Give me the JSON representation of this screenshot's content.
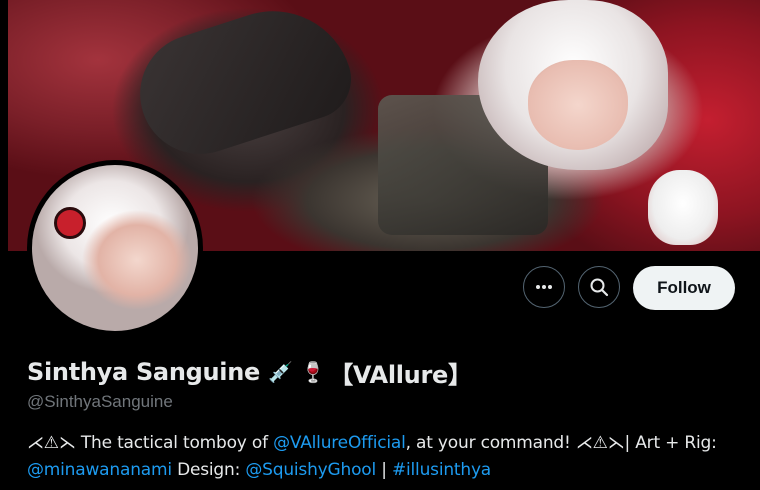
{
  "profile": {
    "display_name": "Sinthya Sanguine",
    "name_emojis": [
      "💉",
      "🍷"
    ],
    "name_tag": "【VAllure】",
    "handle": "@SinthyaSanguine"
  },
  "actions": {
    "more_icon": "more-horizontal-icon",
    "search_icon": "search-icon",
    "follow_label": "Follow"
  },
  "bio": {
    "deco_left": "⋌⚠⋋",
    "part1": "The tactical tomboy of",
    "mention1": "@VAllureOfficial",
    "part2": ", at your command!",
    "deco_right": "⋌⚠⋋",
    "part3": "| Art + Rig:",
    "mention2": "@minawananami",
    "part4": "Design:",
    "mention3": "@SquishyGhool",
    "separator": "|",
    "hashtag": "#illusinthya"
  },
  "colors": {
    "background": "#000000",
    "text": "#e7e9ea",
    "muted": "#71767b",
    "link": "#1d9bf0",
    "follow_bg": "#eff3f4"
  }
}
